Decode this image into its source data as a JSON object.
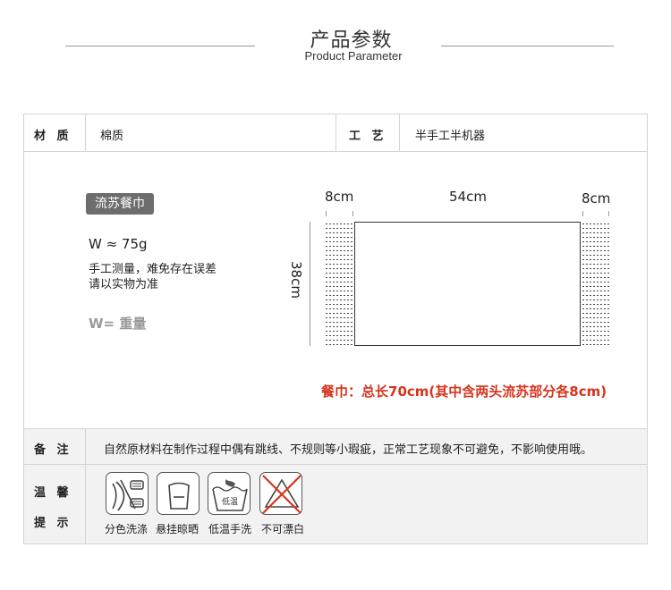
{
  "header": {
    "title": "产品参数",
    "subtitle": "Product Parameter"
  },
  "specs": {
    "material_label": "材 质",
    "material_value": "棉质",
    "craft_label": "工 艺",
    "craft_value": "半手工半机器"
  },
  "product": {
    "name": "流苏餐巾",
    "weight": "W ≈ 75g",
    "measure_note_line1": "手工测量，难免存在误差",
    "measure_note_line2": "请以实物为准",
    "weight_definition": "W= 重量"
  },
  "diagram": {
    "left_fringe": "8cm",
    "body_length": "54cm",
    "right_fringe": "8cm",
    "height": "38cm",
    "total_note": "餐巾：总长70cm(其中含两头流苏部分各8cm)"
  },
  "remarks": {
    "label": "备 注",
    "text": "自然原材料在制作过程中偶有跳线、不规则等小瑕疵，正常工艺现象不可避免，不影响使用哦。"
  },
  "care": {
    "label_line1": "温 馨",
    "label_line2": "提 示",
    "items": [
      {
        "icon": "separate-color-wash-icon",
        "label": "分色洗涤"
      },
      {
        "icon": "hang-dry-icon",
        "label": "悬挂晾晒"
      },
      {
        "icon": "low-temp-hand-wash-icon",
        "label": "低温手洗",
        "icon_text": "低温"
      },
      {
        "icon": "no-bleach-icon",
        "label": "不可漂白"
      }
    ],
    "accent_color": "#d6341d"
  }
}
